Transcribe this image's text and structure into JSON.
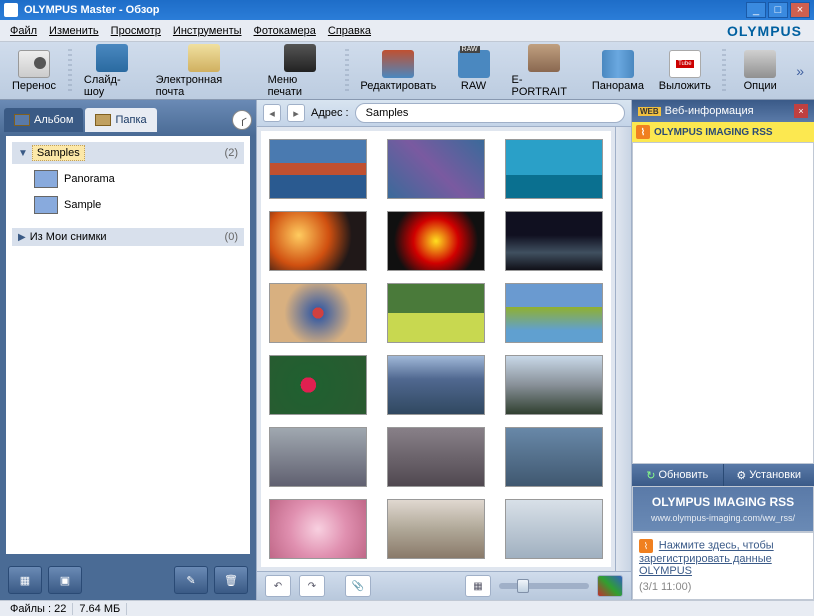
{
  "title": "OLYMPUS Master   - Обзор",
  "window": {
    "min": "_",
    "max": "□",
    "close": "×"
  },
  "brand": "OLYMPUS",
  "menu": [
    "Файл",
    "Изменить",
    "Просмотр",
    "Инструменты",
    "Фотокамера",
    "Справка"
  ],
  "toolbar": [
    {
      "label": "Перенос",
      "icon": "camera"
    },
    {
      "label": "Слайд-шоу",
      "icon": "slideshow"
    },
    {
      "label": "Электронная почта",
      "icon": "mail"
    },
    {
      "label": "Меню печати",
      "icon": "printer"
    },
    {
      "label": "Редактировать",
      "icon": "edit"
    },
    {
      "label": "RAW",
      "icon": "raw"
    },
    {
      "label": "E-PORTRAIT",
      "icon": "portrait"
    },
    {
      "label": "Панорама",
      "icon": "panorama"
    },
    {
      "label": "Выложить",
      "icon": "youtube"
    },
    {
      "label": "Опции",
      "icon": "options"
    }
  ],
  "tabs": {
    "album": "Альбом",
    "folder": "Папка"
  },
  "tree": {
    "samples": {
      "name": "Samples",
      "count": "(2)"
    },
    "items": [
      "Panorama",
      "Sample"
    ],
    "myshots": {
      "name": "Из Мои снимки",
      "count": "(0)"
    }
  },
  "address": {
    "label": "Адрес :",
    "value": "Samples"
  },
  "web": {
    "title": "Веб-информация",
    "rss_title": "OLYMPUS IMAGING RSS",
    "refresh": "Обновить",
    "settings": "Установки",
    "box_title": "OLYMPUS IMAGING RSS",
    "box_url": "www.olympus-imaging.com/ww_rss/",
    "item_text": "Нажмите здесь, чтобы зарегистрировать данные OLYMPUS",
    "item_date": "(3/1 11:00)"
  },
  "status": {
    "files_label": "Файлы :",
    "files": "22",
    "size": "7.64 МБ"
  }
}
